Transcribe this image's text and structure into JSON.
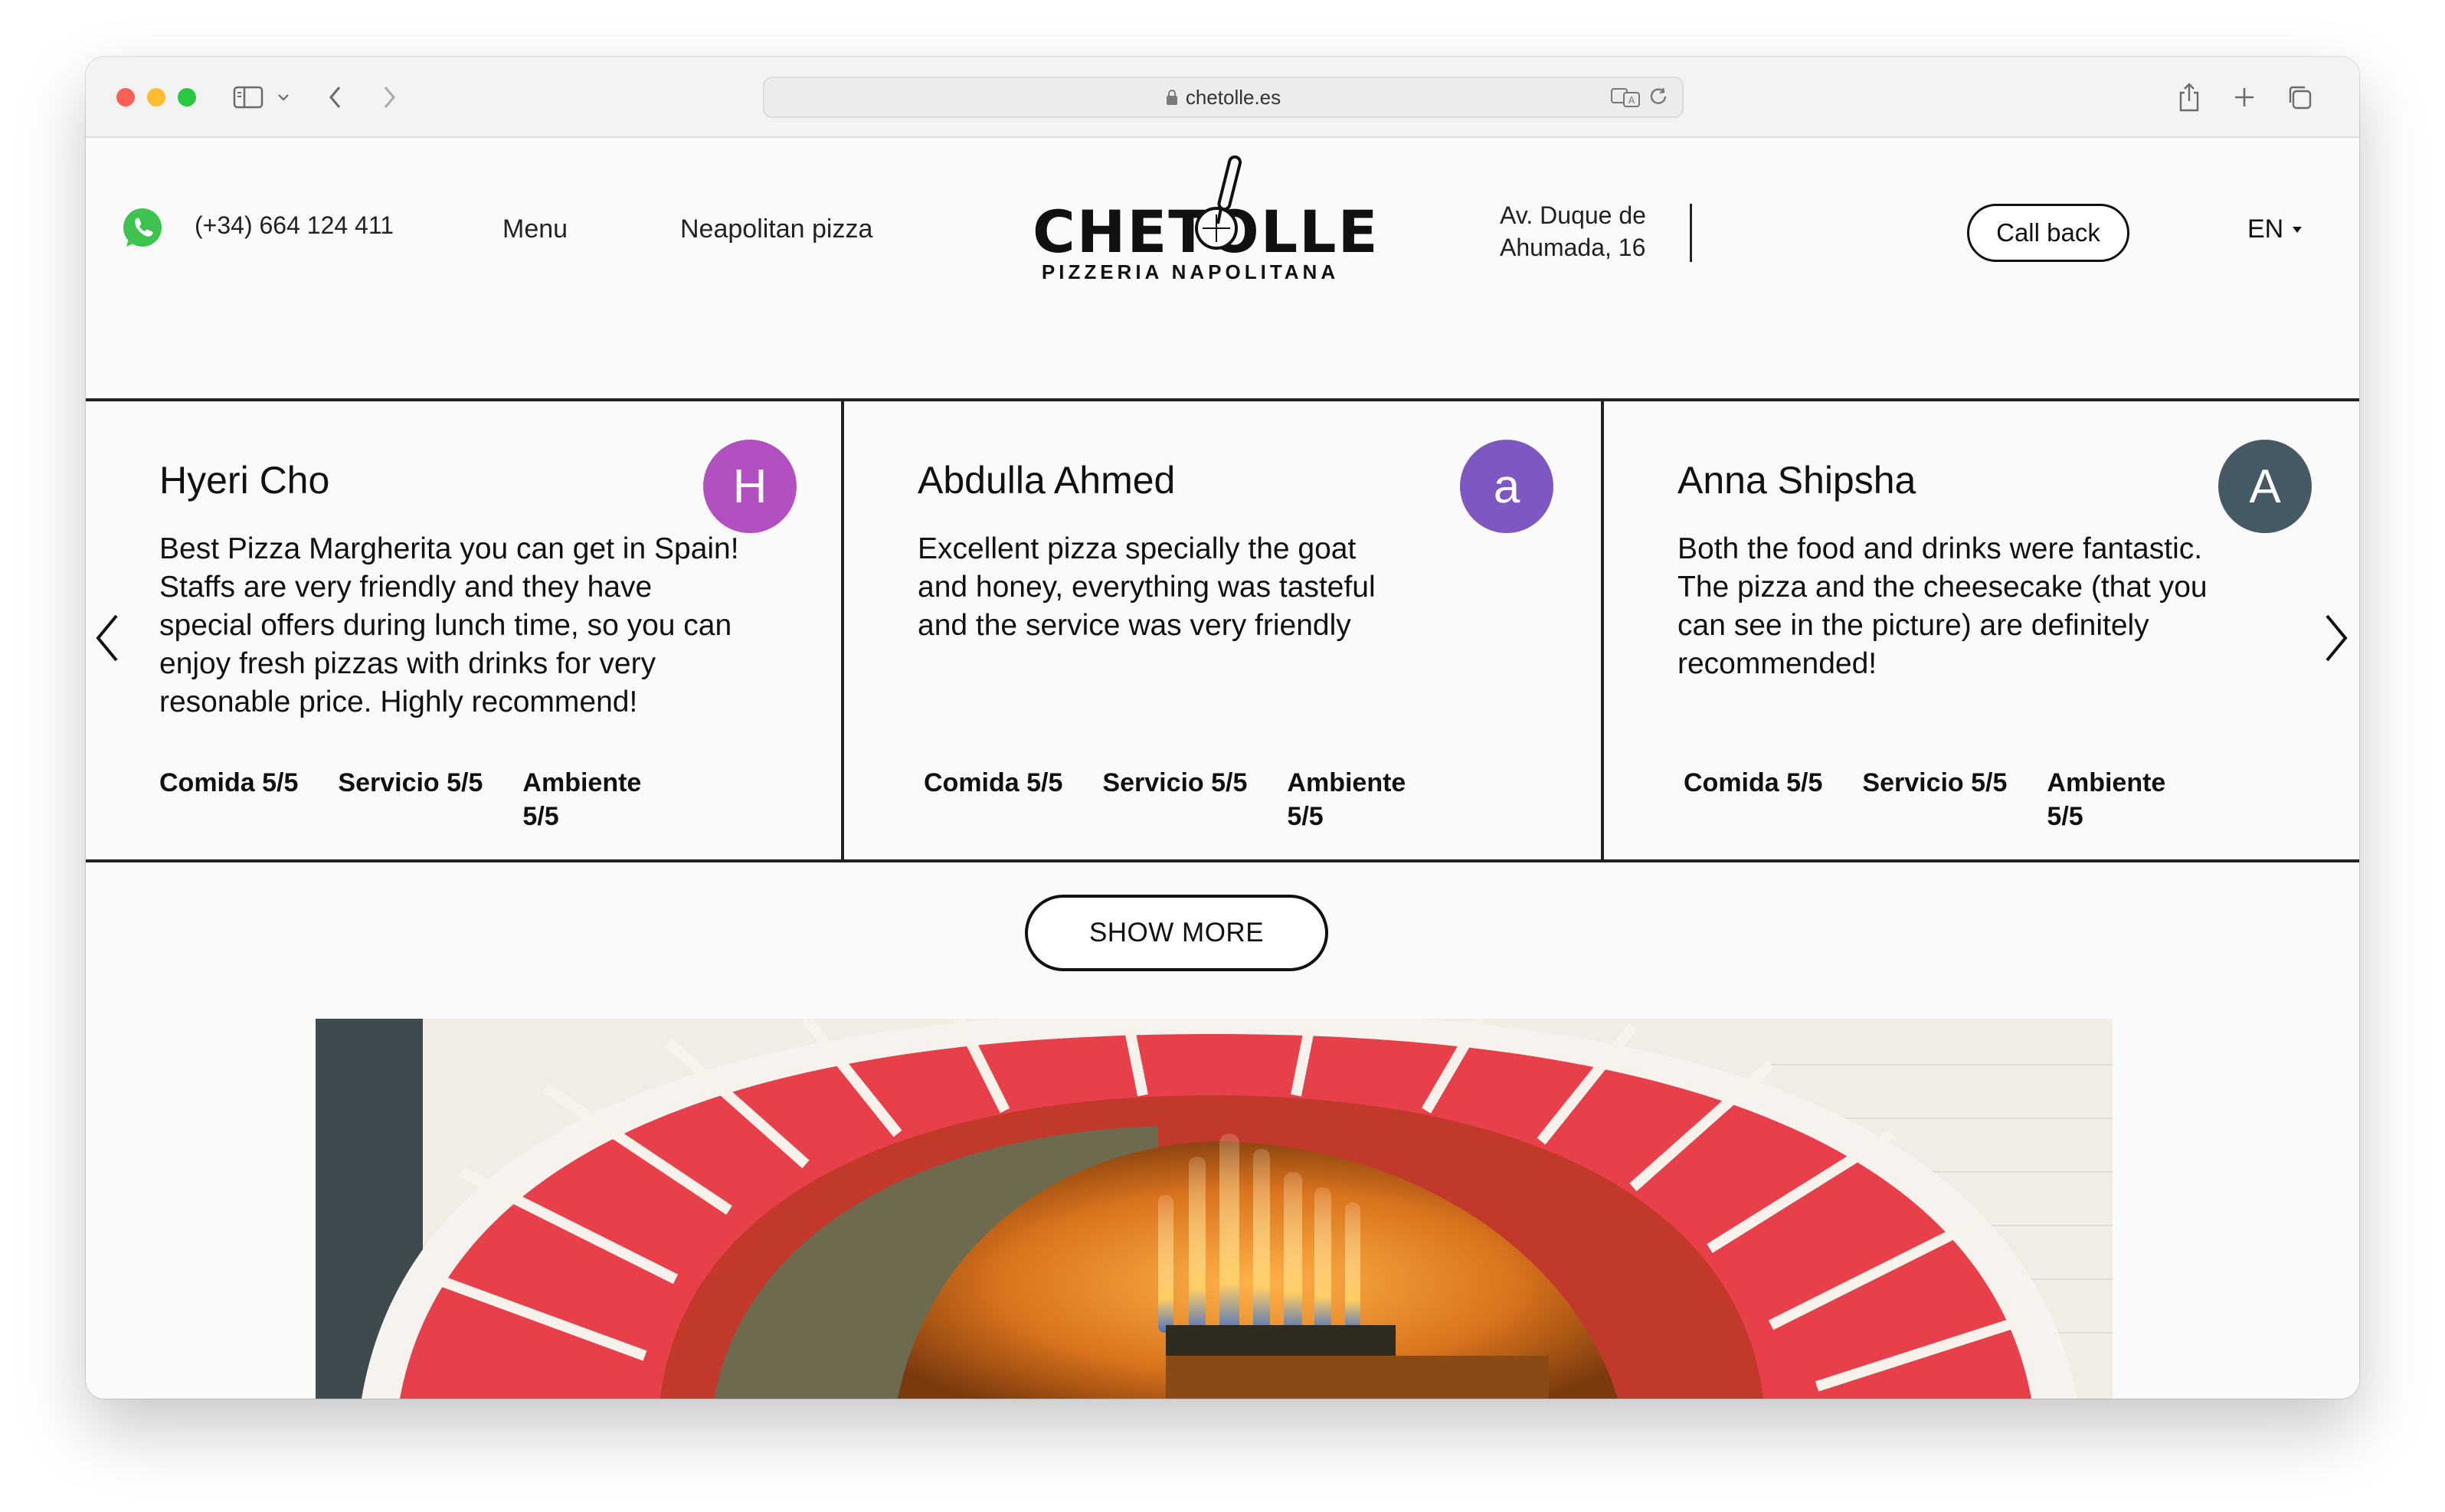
{
  "browser": {
    "url": "chetolle.es"
  },
  "header": {
    "phone": "(+34) 664 124 411",
    "nav": [
      "Menu",
      "Neapolitan pizza"
    ],
    "logo_name": "CHETOLLE",
    "logo_subtitle": "PIZZERIA NAPOLITANA",
    "address_line1": "Av. Duque de",
    "address_line2": "Ahumada, 16",
    "call_back_label": "Call back",
    "language": "EN"
  },
  "reviews": [
    {
      "name": "Hyeri Cho",
      "initial": "H",
      "avatar_color": "#b24fc1",
      "text": "Best Pizza Margherita you can get in Spain! Staffs are very friendly and they have special offers during lunch time, so you can enjoy fresh pizzas with drinks for very resonable price. Highly recommend!",
      "ratings": [
        "Comida 5/5",
        "Servicio 5/5",
        "Ambiente 5/5"
      ]
    },
    {
      "name": "Abdulla Ahmed",
      "initial": "a",
      "avatar_color": "#7e57c2",
      "text": "Excellent pizza specially the goat and honey, everything was tasteful and the service was very friendly",
      "ratings": [
        "Comida 5/5",
        "Servicio 5/5",
        "Ambiente 5/5"
      ]
    },
    {
      "name": "Anna Shipsha",
      "initial": "A",
      "avatar_color": "#455a64",
      "text": "Both the food and drinks were fantastic. The pizza and the cheesecake (that you can see in the picture) are definitely recommended!",
      "ratings": [
        "Comida 5/5",
        "Servicio 5/5",
        "Ambiente 5/5"
      ]
    }
  ],
  "show_more_label": "SHOW MORE",
  "colors": {
    "whatsapp": "#3fc34f",
    "brick_red": "#e8404a",
    "border": "#222222"
  }
}
